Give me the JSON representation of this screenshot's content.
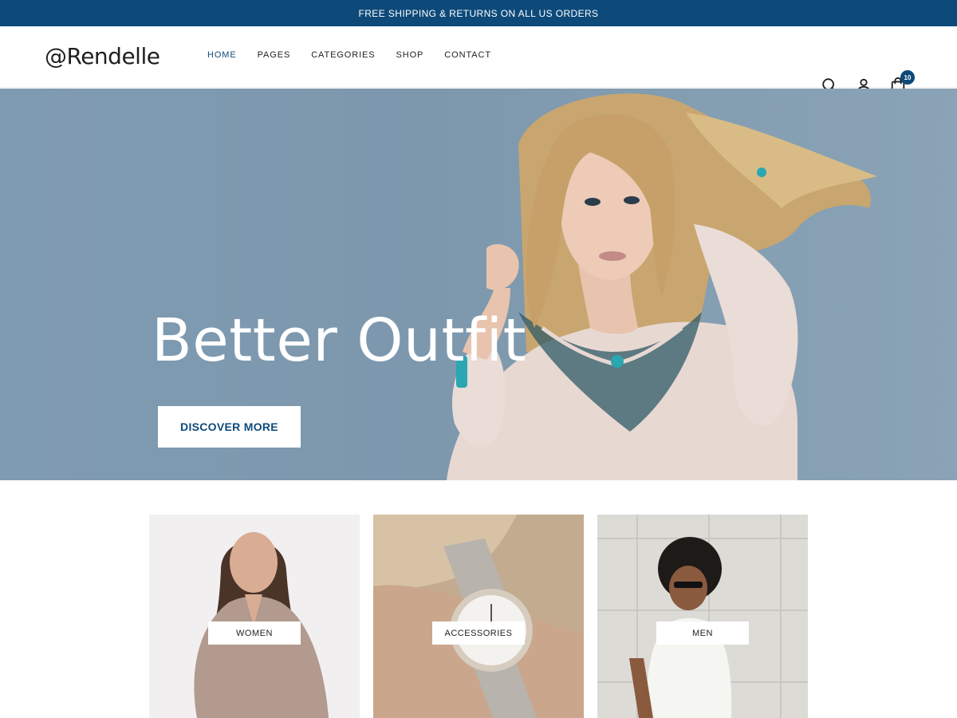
{
  "announcement": "FREE SHIPPING & RETURNS ON ALL US ORDERS",
  "header": {
    "logo": "@Rendelle",
    "nav": [
      "HOME",
      "PAGES",
      "CATEGORIES",
      "SHOP",
      "CONTACT"
    ],
    "active_nav": "HOME",
    "cart_count": "10",
    "icons": [
      "search-icon",
      "user-icon",
      "cart-icon"
    ]
  },
  "hero": {
    "title": "Better Outfit",
    "cta": "DISCOVER MORE"
  },
  "categories": [
    {
      "label": "WOMEN"
    },
    {
      "label": "ACCESSORIES"
    },
    {
      "label": "MEN"
    }
  ],
  "colors": {
    "brand": "#0d4a7a",
    "hero_bg": "#7f9bb2"
  }
}
